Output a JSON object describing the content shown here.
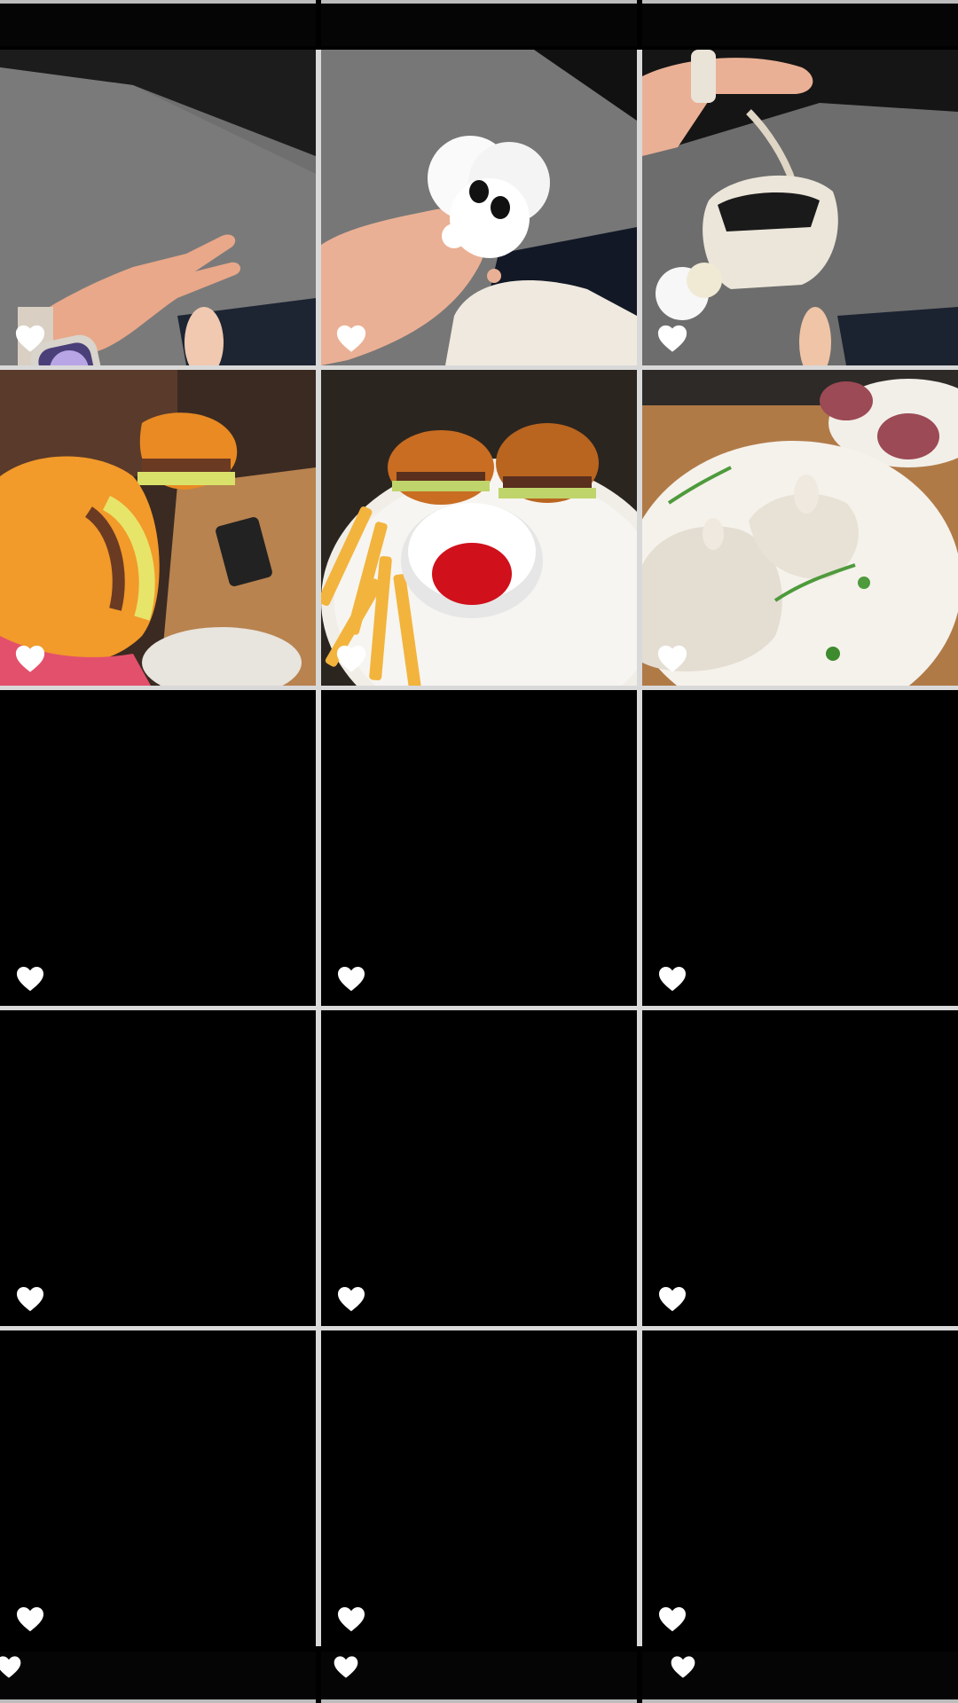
{
  "gallery": {
    "columns": 3,
    "tiles": [
      {
        "kind": "photo",
        "scene": "hand-watch",
        "liked_icon": "heart-outline-icon"
      },
      {
        "kind": "photo",
        "scene": "fluffy-toy",
        "liked_icon": "heart-outline-icon"
      },
      {
        "kind": "photo",
        "scene": "white-bag",
        "liked_icon": "heart-outline-icon"
      },
      {
        "kind": "photo",
        "scene": "burger-hand",
        "liked_icon": "heart-outline-icon"
      },
      {
        "kind": "photo",
        "scene": "burgers-fries",
        "liked_icon": "heart-outline-icon"
      },
      {
        "kind": "photo",
        "scene": "dumplings",
        "liked_icon": "heart-outline-icon"
      },
      {
        "kind": "empty",
        "liked_icon": "heart-filled-icon"
      },
      {
        "kind": "empty",
        "liked_icon": "heart-filled-icon"
      },
      {
        "kind": "empty",
        "liked_icon": "heart-filled-icon"
      },
      {
        "kind": "empty",
        "liked_icon": "heart-filled-icon"
      },
      {
        "kind": "empty",
        "liked_icon": "heart-filled-icon"
      },
      {
        "kind": "empty",
        "liked_icon": "heart-filled-icon"
      },
      {
        "kind": "empty",
        "liked_icon": "heart-filled-icon"
      },
      {
        "kind": "empty",
        "liked_icon": "heart-filled-icon"
      },
      {
        "kind": "empty",
        "liked_icon": "heart-filled-icon"
      }
    ]
  },
  "colors": {
    "background": "#000000",
    "divider": "#d9d9d9",
    "heart": "#ffffff"
  }
}
